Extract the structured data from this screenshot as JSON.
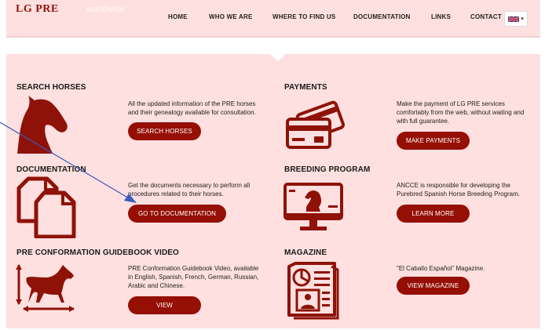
{
  "header": {
    "logo": "LG PRE",
    "tagline": "worldwide",
    "nav": [
      "HOME",
      "WHO WE ARE",
      "WHERE TO FIND US",
      "DOCUMENTATION",
      "LINKS",
      "CONTACT"
    ],
    "language_icon": "uk-flag-icon"
  },
  "sections": {
    "search_horses": {
      "title": "SEARCH HORSES",
      "desc": [
        "All the updated information of the PRE horses",
        "and their genealogy available for consultation."
      ],
      "button": "SEARCH HORSES",
      "icon": "horse-head-icon"
    },
    "payments": {
      "title": "PAYMENTS",
      "desc": [
        "Make the payment of LG PRE services",
        "comfortably from the web, without waiting and",
        "with full guarantee."
      ],
      "button": "MAKE PAYMENTS",
      "icon": "credit-cards-icon"
    },
    "documentation": {
      "title": "DOCUMENTATION",
      "desc": [
        "Get the documents necessary to perform all",
        "procedures related to their horses."
      ],
      "button": "GO TO DOCUMENTATION",
      "icon": "documents-icon"
    },
    "breeding_program": {
      "title": "BREEDING PROGRAM",
      "desc": [
        "ANCCE is responsible for developing the",
        "Purebred Spanish Horse Breeding Program."
      ],
      "button": "LEARN MORE",
      "icon": "chess-knight-monitor-icon"
    },
    "guidebook_video": {
      "title": "PRE CONFORMATION GUIDEBOOK VIDEO",
      "desc": [
        "PRE Conformation Guidebook Video, available",
        "in English, Spanish, French, German, Russian,",
        "Arabic and Chinese."
      ],
      "button": "VIEW",
      "icon": "horse-measure-icon"
    },
    "magazine": {
      "title": "MAGAZINE",
      "desc": [
        "\"El Caballo Español\" Magazine."
      ],
      "button": "VIEW MAGAZINE",
      "icon": "newspaper-icon"
    }
  },
  "colors": {
    "accent": "#950f05",
    "panel": "#fde0df",
    "annotation_arrow": "#3a5bbf"
  }
}
